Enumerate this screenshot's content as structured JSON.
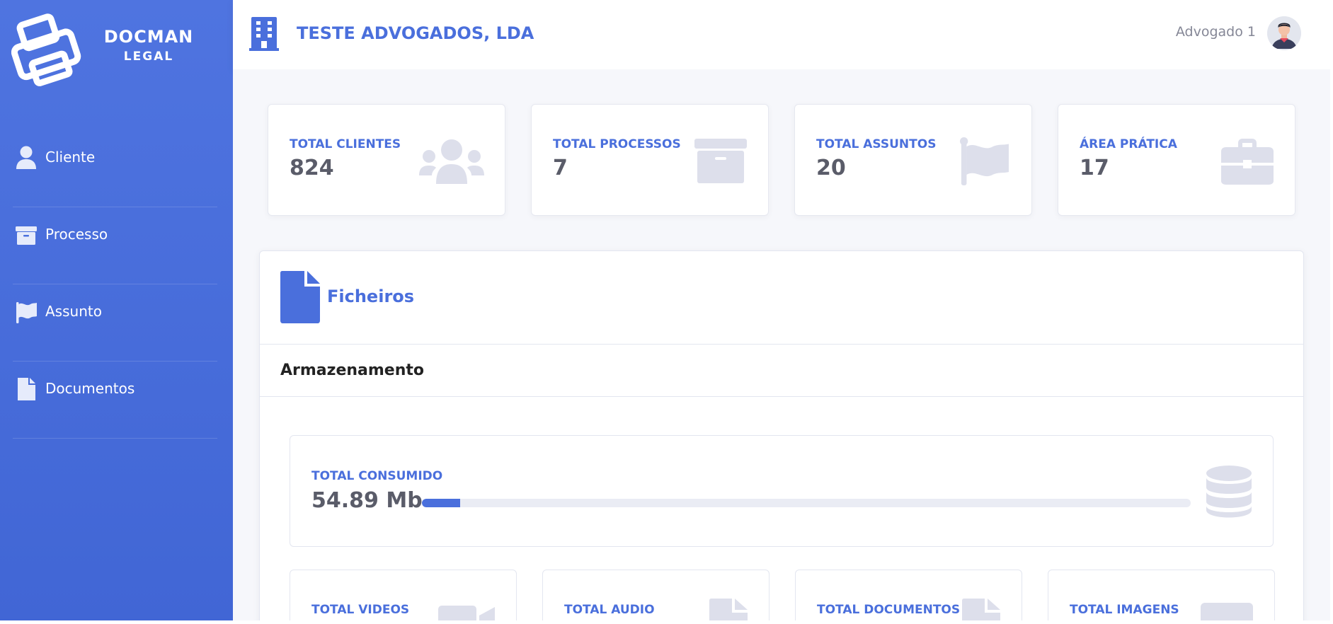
{
  "brand": {
    "title": "DOCMAN",
    "subtitle": "LEGAL"
  },
  "sidebar": {
    "items": [
      {
        "label": "Cliente",
        "icon": "user-icon"
      },
      {
        "label": "Processo",
        "icon": "archive-icon"
      },
      {
        "label": "Assunto",
        "icon": "flag-icon"
      },
      {
        "label": "Documentos",
        "icon": "file-icon"
      }
    ]
  },
  "header": {
    "company": "TESTE ADVOGADOS, LDA",
    "company_icon": "building-icon",
    "user_name": "Advogado 1",
    "avatar_icon": "avatar-icon"
  },
  "stats": [
    {
      "label": "TOTAL CLIENTES",
      "value": "824",
      "icon": "users-icon"
    },
    {
      "label": "TOTAL PROCESSOS",
      "value": "7",
      "icon": "archive-icon"
    },
    {
      "label": "TOTAL ASSUNTOS",
      "value": "20",
      "icon": "flag-icon"
    },
    {
      "label": "ÁREA PRÁTICA",
      "value": "17",
      "icon": "briefcase-icon"
    }
  ],
  "files": {
    "title": "Ficheiros",
    "storage_title": "Armazenamento",
    "consumed_label": "TOTAL CONSUMIDO",
    "consumed_value": "54.89 Mb",
    "consumed_fraction": 0.05,
    "media": [
      {
        "label": "TOTAL VIDEOS",
        "icon": "video-icon"
      },
      {
        "label": "TOTAL AUDIO",
        "icon": "audio-file-icon"
      },
      {
        "label": "TOTAL DOCUMENTOS",
        "icon": "document-file-icon"
      },
      {
        "label": "TOTAL IMAGENS",
        "icon": "image-icon"
      }
    ]
  },
  "colors": {
    "accent": "#4a6fdc",
    "sidebar_top": "#4f74e0",
    "sidebar_bottom": "#4166d5",
    "icon_muted": "#dddfeb",
    "value_text": "#5a5c69"
  }
}
